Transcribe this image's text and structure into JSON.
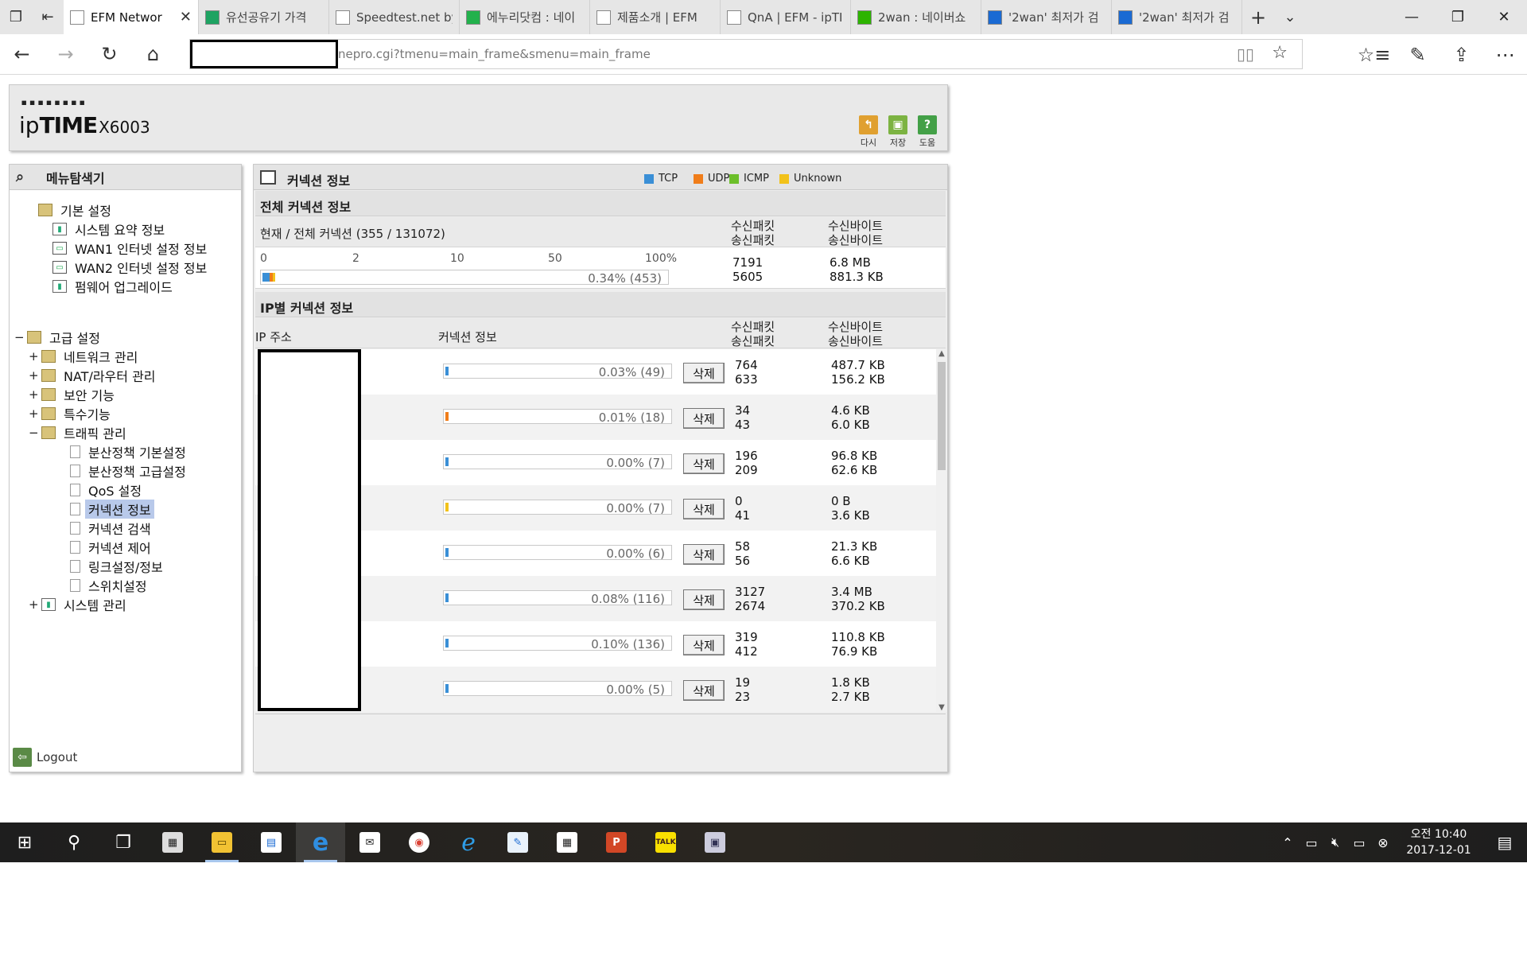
{
  "browser": {
    "tabs": [
      {
        "label": "EFM Networ",
        "active": true,
        "favicon_color": "#ffffff"
      },
      {
        "label": "유선공유기 가격",
        "active": false,
        "favicon_color": "#1ea362"
      },
      {
        "label": "Speedtest.net by",
        "active": false,
        "favicon_color": "#ffffff"
      },
      {
        "label": "에누리닷컴 : 네이",
        "active": false,
        "favicon_color": "#22b14c"
      },
      {
        "label": "제품소개 | EFM",
        "active": false,
        "favicon_color": "#ffffff"
      },
      {
        "label": "QnA | EFM - ipTI",
        "active": false,
        "favicon_color": "#ffffff"
      },
      {
        "label": "2wan : 네이버쇼",
        "active": false,
        "favicon_color": "#2db400"
      },
      {
        "label": "'2wan' 최저가 검",
        "active": false,
        "favicon_color": "#1a6ad3"
      },
      {
        "label": "'2wan' 최저가 검",
        "active": false,
        "favicon_color": "#1a6ad3"
      }
    ],
    "address_url": "nepro.cgi?tmenu=main_frame&smenu=main_frame"
  },
  "header": {
    "logo_top": "▪▪▪▪▪▪▪▪",
    "logo_ip": "ip",
    "logo_time": "TIME",
    "logo_model": "X6003",
    "buttons": [
      {
        "label": "다시",
        "color": "#e0a030"
      },
      {
        "label": "저장",
        "color": "#7cb342"
      },
      {
        "label": "도움",
        "color": "#43a047"
      }
    ]
  },
  "menu": {
    "title": "메뉴탐색기",
    "items": [
      {
        "label": "기본 설정",
        "expander": "",
        "icon": "folder"
      },
      {
        "label": "시스템 요약 정보",
        "expander": "",
        "icon": "chart"
      },
      {
        "label": "WAN1 인터넷 설정 정보",
        "expander": "",
        "icon": "monitor"
      },
      {
        "label": "WAN2 인터넷 설정 정보",
        "expander": "",
        "icon": "monitor"
      },
      {
        "label": "펌웨어 업그레이드",
        "expander": "",
        "icon": "chart"
      },
      {
        "label": "고급 설정",
        "expander": "−",
        "icon": "folder"
      },
      {
        "label": "네트워크 관리",
        "expander": "+",
        "icon": "folder"
      },
      {
        "label": "NAT/라우터 관리",
        "expander": "+",
        "icon": "folder"
      },
      {
        "label": "보안 기능",
        "expander": "+",
        "icon": "folder"
      },
      {
        "label": "특수기능",
        "expander": "+",
        "icon": "folder"
      },
      {
        "label": "트래픽 관리",
        "expander": "−",
        "icon": "folder"
      },
      {
        "label": "분산정책 기본설정",
        "expander": "",
        "icon": "page"
      },
      {
        "label": "분산정책 고급설정",
        "expander": "",
        "icon": "page"
      },
      {
        "label": "QoS 설정",
        "expander": "",
        "icon": "page"
      },
      {
        "label": "커넥션 정보",
        "expander": "",
        "icon": "page",
        "selected": true
      },
      {
        "label": "커넥션 검색",
        "expander": "",
        "icon": "page"
      },
      {
        "label": "커넥션 제어",
        "expander": "",
        "icon": "page"
      },
      {
        "label": "링크설정/정보",
        "expander": "",
        "icon": "page"
      },
      {
        "label": "스위치설정",
        "expander": "",
        "icon": "page"
      },
      {
        "label": "시스템 관리",
        "expander": "+",
        "icon": "chart"
      }
    ],
    "logout": "Logout"
  },
  "main": {
    "title": "커넥션 정보",
    "legend": [
      {
        "label": "TCP",
        "color": "#3a8fd6"
      },
      {
        "label": "UDP",
        "color": "#f07d1a"
      },
      {
        "label": "ICMP",
        "color": "#6cbf2a"
      },
      {
        "label": "Unknown",
        "color": "#f2c21a"
      }
    ],
    "total": {
      "section_title": "전체 커넥션 정보",
      "summary": "현재 / 전체 커넥션 (355 / 131072)",
      "col_packets_rx": "수신패킷",
      "col_packets_tx": "송신패킷",
      "col_bytes_rx": "수신바이트",
      "col_bytes_tx": "송신바이트",
      "scale": [
        "0",
        "2",
        "10",
        "50",
        "100%"
      ],
      "bar_value": "0.34% (453)",
      "bar_fraction": 0.0034,
      "rx_packets": "7191",
      "tx_packets": "5605",
      "rx_bytes": "6.8 MB",
      "tx_bytes": "881.3 KB"
    },
    "per_ip": {
      "section_title": "IP별 커넥션 정보",
      "col_ip": "IP 주소",
      "col_conn": "커넥션 정보",
      "col_packets_rx": "수신패킷",
      "col_packets_tx": "송신패킷",
      "col_bytes_rx": "수신바이트",
      "col_bytes_tx": "송신바이트",
      "delete_label": "삭제",
      "rows": [
        {
          "bar_value": "0.03% (49)",
          "rx_packets": "764",
          "tx_packets": "633",
          "rx_bytes": "487.7 KB",
          "tx_bytes": "156.2 KB",
          "color": "#3a8fd6"
        },
        {
          "bar_value": "0.01% (18)",
          "rx_packets": "34",
          "tx_packets": "43",
          "rx_bytes": "4.6 KB",
          "tx_bytes": "6.0 KB",
          "color": "#f07d1a"
        },
        {
          "bar_value": "0.00% (7)",
          "rx_packets": "196",
          "tx_packets": "209",
          "rx_bytes": "96.8 KB",
          "tx_bytes": "62.6 KB",
          "color": "#3a8fd6"
        },
        {
          "bar_value": "0.00% (7)",
          "rx_packets": "0",
          "tx_packets": "41",
          "rx_bytes": "0 B",
          "tx_bytes": "3.6 KB",
          "color": "#f2c21a"
        },
        {
          "bar_value": "0.00% (6)",
          "rx_packets": "58",
          "tx_packets": "56",
          "rx_bytes": "21.3 KB",
          "tx_bytes": "6.6 KB",
          "color": "#3a8fd6"
        },
        {
          "bar_value": "0.08% (116)",
          "rx_packets": "3127",
          "tx_packets": "2674",
          "rx_bytes": "3.4 MB",
          "tx_bytes": "370.2 KB",
          "color": "#3a8fd6"
        },
        {
          "bar_value": "0.10% (136)",
          "rx_packets": "319",
          "tx_packets": "412",
          "rx_bytes": "110.8 KB",
          "tx_bytes": "76.9 KB",
          "color": "#3a8fd6"
        },
        {
          "bar_value": "0.00% (5)",
          "rx_packets": "19",
          "tx_packets": "23",
          "rx_bytes": "1.8 KB",
          "tx_bytes": "2.7 KB",
          "color": "#3a8fd6"
        }
      ]
    }
  },
  "taskbar": {
    "clock_time": "오전 10:40",
    "clock_date": "2017-12-01"
  }
}
